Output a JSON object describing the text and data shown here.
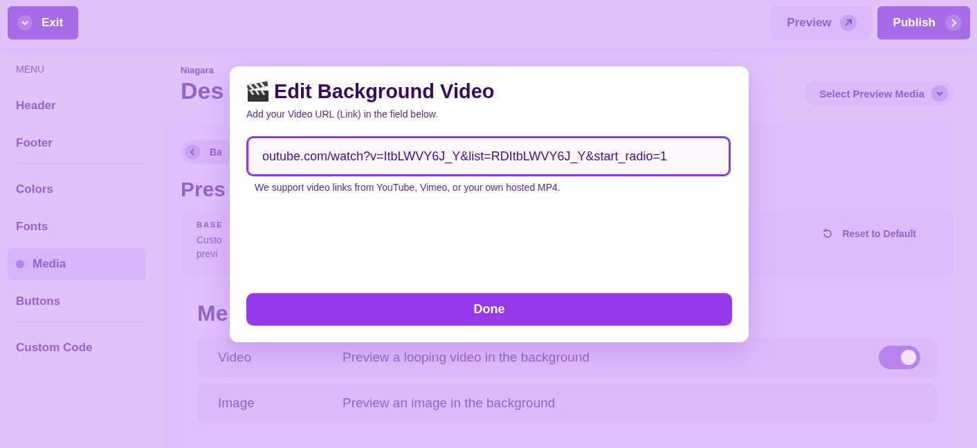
{
  "topbar": {
    "exit_button": "Exit",
    "preview_button": "Preview",
    "publish_button": "Publish"
  },
  "sidebar": {
    "heading": "MENU",
    "groups": [
      [
        {
          "label": "Header",
          "selected": false
        },
        {
          "label": "Footer",
          "selected": false
        }
      ],
      [
        {
          "label": "Colors",
          "selected": false
        },
        {
          "label": "Fonts",
          "selected": false
        },
        {
          "label": "Media",
          "selected": true
        },
        {
          "label": "Buttons",
          "selected": false
        }
      ],
      [
        {
          "label": "Custom Code",
          "selected": false
        }
      ]
    ]
  },
  "main": {
    "breadcrumb": "Niagara",
    "title": "Des",
    "select_preview": "Select Preview Media",
    "back_button": "Ba",
    "section_title": "Pres",
    "base_card": {
      "label": "BASE",
      "description_lines": [
        "Custo",
        "previ"
      ],
      "reset_button": "Reset to Default"
    },
    "media_card": {
      "title": "Me",
      "rows": [
        {
          "label": "Video",
          "description": "Preview a looping video in the background",
          "toggle": {
            "on": true
          }
        },
        {
          "label": "Image",
          "description": "Preview an image in the background"
        }
      ]
    }
  },
  "modal": {
    "title": "Edit Background Video",
    "subtitle": "Add your Video URL (Link) in the field below.",
    "url_field": {
      "value": "outube.com/watch?v=ItbLWVY6J_Y&list=RDItbLWVY6J_Y&start_radio=1"
    },
    "hint": "We support video links from YouTube, Vimeo, or your own hosted MP4.",
    "done_button": "Done"
  }
}
